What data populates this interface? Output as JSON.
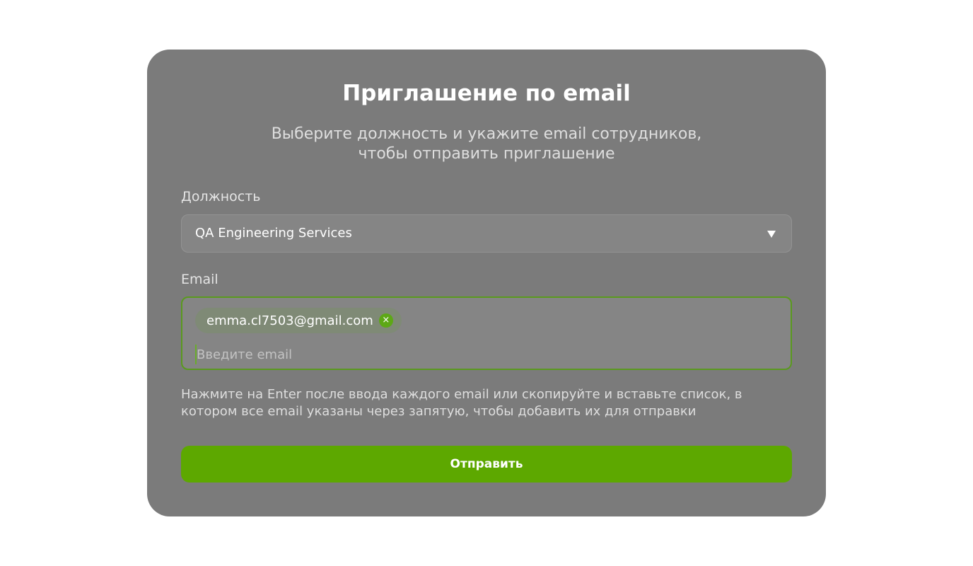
{
  "dialog": {
    "title": "Приглашение по email",
    "subtitle_line1": "Выберите должность и укажите email сотрудников,",
    "subtitle_line2": "чтобы отправить приглашение"
  },
  "role": {
    "label": "Должность",
    "selected": "QA Engineering Services",
    "icon": "caret-down-icon"
  },
  "email": {
    "label": "Email",
    "chips": [
      {
        "label": "emma.cl7503@gmail.com",
        "remove_glyph": "×"
      }
    ],
    "input_value": "",
    "placeholder": "Введите email"
  },
  "hint": {
    "line1": "Нажмите на Enter после ввода каждого email или скопируйте и вставьте список, в",
    "line2": "котором все email указаны через запятую, чтобы добавить их для отправки"
  },
  "submit": {
    "label": "Отправить"
  },
  "colors": {
    "card_bg": "#7b7b7b",
    "accent": "#5da800",
    "focus_border": "#5a9a1e"
  }
}
